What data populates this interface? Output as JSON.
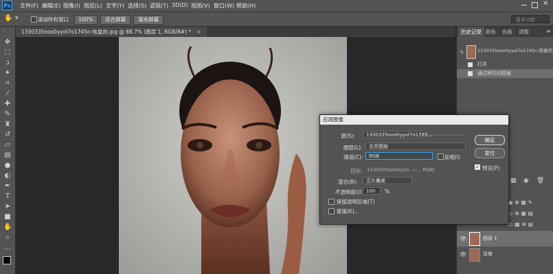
{
  "app": {
    "logo_text": "Ps"
  },
  "menu": [
    "文件(F)",
    "编辑(E)",
    "图像(I)",
    "图层(L)",
    "文字(Y)",
    "选择(S)",
    "滤镜(T)",
    "3D(D)",
    "视图(V)",
    "窗口(W)",
    "帮助(H)"
  ],
  "options_bar": {
    "scroll_all_label": "滚动所有窗口",
    "zoom_value": "100%",
    "fit_screen_label": "适合屏幕",
    "fill_screen_label": "填充屏幕",
    "workspace_value": "基本功能"
  },
  "document": {
    "tab_title": "1330335ooo0yyol7o1745n-恢复的.jpg @ 88.7% (图层 1, RGB/8#) *",
    "tab_close": "×"
  },
  "panels": {
    "tabs": [
      "历史记录",
      "颜色",
      "色板",
      "调整"
    ],
    "history_snapshot_name": "1330335ooo0yyol7o1745n-恢复的.jpg",
    "history_items": [
      "打开",
      "通过拷贝的图层"
    ],
    "layers": [
      {
        "name": "图层 1"
      },
      {
        "name": "背景"
      }
    ]
  },
  "dialog": {
    "title": "应用图像",
    "source_label": "源(S):",
    "source_value": "1330335ooo0yyol7o1745...",
    "layer_label": "图层(L):",
    "layer_value": "合并图层",
    "channel_label": "通道(C):",
    "channel_value": "RGB",
    "invert_label": "反相(I)",
    "target_label": "目标:",
    "target_value": "1330335ooo0yyo...(..., RGB)",
    "blending_label": "混合(B):",
    "blending_value": "正片叠底",
    "opacity_label": "不透明度(O):",
    "opacity_value": "100",
    "opacity_unit": "%",
    "preserve_label": "保留透明区域(T)",
    "mask_label": "蒙版(K)...",
    "ok_label": "确定",
    "reset_label": "复位",
    "preview_label": "预览(P)"
  },
  "colors": {
    "accent": "#31a8ff",
    "panel": "#535353",
    "dark": "#282828"
  }
}
